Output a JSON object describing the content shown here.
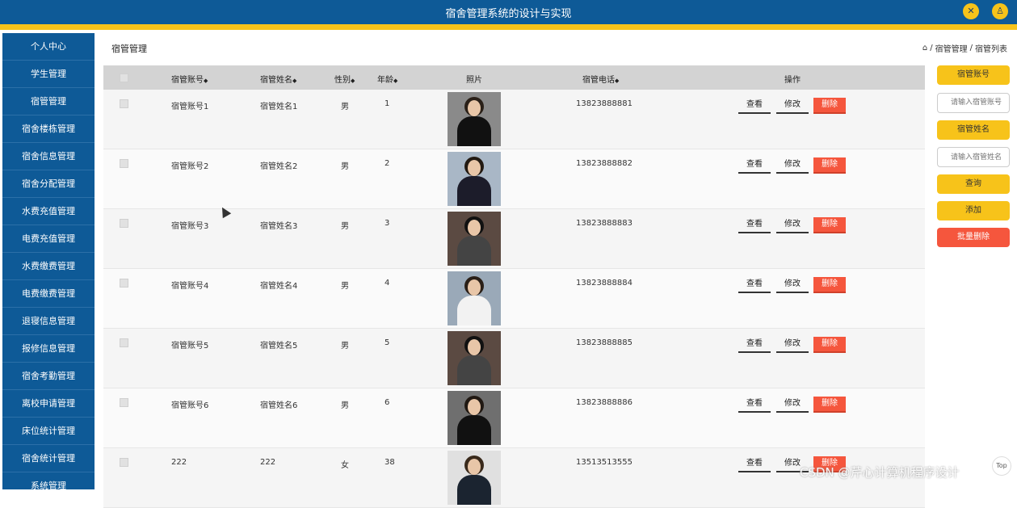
{
  "app_title": "宿舍管理系统的设计与实现",
  "header_icons": [
    "fullscreen-icon",
    "user-icon"
  ],
  "sidebar": {
    "items": [
      "个人中心",
      "学生管理",
      "宿管管理",
      "宿舍楼栋管理",
      "宿舍信息管理",
      "宿舍分配管理",
      "水费充值管理",
      "电费充值管理",
      "水费缴费管理",
      "电费缴费管理",
      "退寝信息管理",
      "报修信息管理",
      "宿舍考勤管理",
      "离校申请管理",
      "床位统计管理",
      "宿舍统计管理",
      "系统管理"
    ]
  },
  "page_title": "宿管管理",
  "breadcrumb": [
    "宿管管理",
    "宿管列表"
  ],
  "table": {
    "headers": [
      "宿管账号",
      "宿管姓名",
      "性别",
      "年龄",
      "照片",
      "宿管电话",
      "操作"
    ],
    "sort_glyph": "◆",
    "rows": [
      {
        "account": "宿管账号1",
        "name": "宿管姓名1",
        "gender": "男",
        "age": "1",
        "phone": "13823888881"
      },
      {
        "account": "宿管账号2",
        "name": "宿管姓名2",
        "gender": "男",
        "age": "2",
        "phone": "13823888882"
      },
      {
        "account": "宿管账号3",
        "name": "宿管姓名3",
        "gender": "男",
        "age": "3",
        "phone": "13823888883"
      },
      {
        "account": "宿管账号4",
        "name": "宿管姓名4",
        "gender": "男",
        "age": "4",
        "phone": "13823888884"
      },
      {
        "account": "宿管账号5",
        "name": "宿管姓名5",
        "gender": "男",
        "age": "5",
        "phone": "13823888885"
      },
      {
        "account": "宿管账号6",
        "name": "宿管姓名6",
        "gender": "男",
        "age": "6",
        "phone": "13823888886"
      },
      {
        "account": "222",
        "name": "222",
        "gender": "女",
        "age": "38",
        "phone": "13513513555"
      }
    ],
    "actions": {
      "view": "查看",
      "edit": "修改",
      "delete": "删除"
    }
  },
  "search_panel": {
    "account_label": "宿管账号",
    "account_placeholder": "请输入宿管账号",
    "name_label": "宿管姓名",
    "name_placeholder": "请输入宿管姓名",
    "query_button": "查询",
    "add_button": "添加",
    "batch_delete_button": "批量删除"
  },
  "watermark": "CSDN @芹心计算机程序设计",
  "top_button": "Top",
  "colors": {
    "primary": "#0e5a97",
    "accent": "#f7c31a",
    "danger": "#f5563d",
    "header_row": "#d3d3d3"
  }
}
